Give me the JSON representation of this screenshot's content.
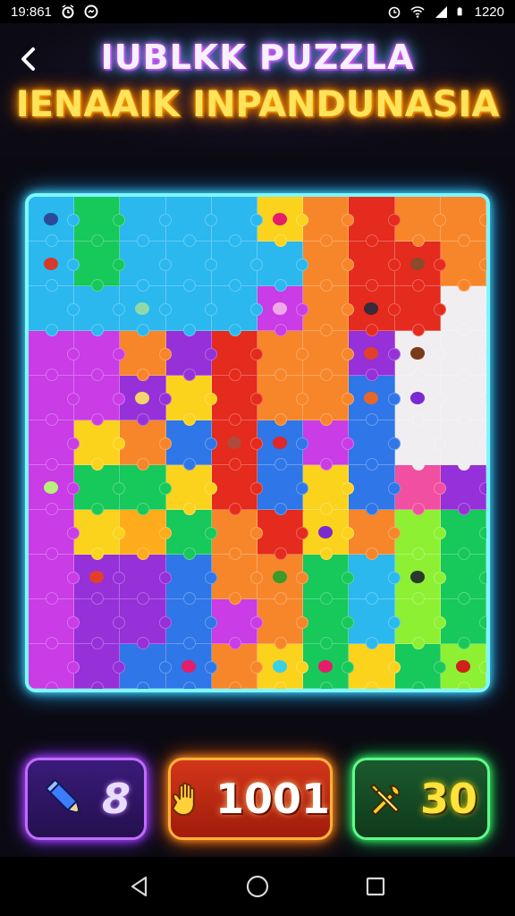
{
  "status_bar": {
    "time": "19:861",
    "battery_text": "1220",
    "left_icons": [
      "alarm-icon",
      "messenger-icon"
    ],
    "right_icons": [
      "alarm-clock-icon",
      "wifi-icon",
      "signal-icon",
      "battery-icon"
    ]
  },
  "header": {
    "back_icon": "chevron-left-icon",
    "title_line1": "IUBLKK PUZZLA",
    "title_line2": "IENAAIK INPANDUNASIA"
  },
  "board": {
    "columns": 10,
    "rows": 11,
    "frame_color": "#7ff7ff",
    "palette": {
      "G": "#17c85b",
      "C": "#2ab8ef",
      "B": "#2f76e8",
      "Y": "#fbd31c",
      "O": "#f7862a",
      "R": "#e52a1e",
      "M": "#c93ce6",
      "P": "#9630d8",
      "W": "#f1eef2",
      "L": "#8df033",
      "K": "#f14fa0",
      "A": "#ffac1c"
    },
    "rows_colors": [
      [
        "C",
        "G",
        "C",
        "C",
        "C",
        "Y",
        "O",
        "R",
        "O",
        "O"
      ],
      [
        "C",
        "G",
        "C",
        "C",
        "C",
        "C",
        "O",
        "R",
        "R",
        "O"
      ],
      [
        "C",
        "C",
        "C",
        "C",
        "C",
        "M",
        "O",
        "R",
        "R",
        "W"
      ],
      [
        "M",
        "M",
        "O",
        "P",
        "R",
        "O",
        "O",
        "P",
        "W",
        "W"
      ],
      [
        "M",
        "M",
        "P",
        "Y",
        "R",
        "O",
        "O",
        "B",
        "W",
        "W"
      ],
      [
        "M",
        "Y",
        "O",
        "B",
        "R",
        "B",
        "M",
        "B",
        "W",
        "W"
      ],
      [
        "M",
        "G",
        "G",
        "Y",
        "R",
        "B",
        "Y",
        "B",
        "K",
        "P"
      ],
      [
        "M",
        "Y",
        "A",
        "G",
        "O",
        "R",
        "Y",
        "O",
        "L",
        "G"
      ],
      [
        "M",
        "P",
        "P",
        "B",
        "O",
        "O",
        "G",
        "C",
        "L",
        "G"
      ],
      [
        "M",
        "P",
        "P",
        "B",
        "M",
        "O",
        "G",
        "C",
        "L",
        "G"
      ],
      [
        "M",
        "P",
        "B",
        "B",
        "O",
        "Y",
        "G",
        "Y",
        "G",
        "L"
      ]
    ],
    "marks": [
      {
        "row": 0,
        "col": 0,
        "color": "#2b4b9a",
        "icon": "bug-icon"
      },
      {
        "row": 0,
        "col": 5,
        "color": "#e51d6a",
        "icon": "gem-icon"
      },
      {
        "row": 1,
        "col": 0,
        "color": "#d63a2a",
        "icon": "gem-icon"
      },
      {
        "row": 1,
        "col": 8,
        "color": "#8b4a2a",
        "icon": "critter-icon"
      },
      {
        "row": 2,
        "col": 2,
        "color": "#8fd9a8",
        "icon": "gem-icon"
      },
      {
        "row": 2,
        "col": 5,
        "color": "#f0a8e8",
        "icon": "gem-icon"
      },
      {
        "row": 2,
        "col": 7,
        "color": "#3a2a3a",
        "icon": "monster-icon"
      },
      {
        "row": 3,
        "col": 7,
        "color": "#e0402a",
        "icon": "critter-icon"
      },
      {
        "row": 3,
        "col": 8,
        "color": "#7a3b1a",
        "icon": "critter-icon"
      },
      {
        "row": 4,
        "col": 2,
        "color": "#f5d56a",
        "icon": "critter-icon"
      },
      {
        "row": 4,
        "col": 7,
        "color": "#e8662a",
        "icon": "gem-icon"
      },
      {
        "row": 4,
        "col": 8,
        "color": "#7a2ad0",
        "icon": "gem-icon"
      },
      {
        "row": 5,
        "col": 4,
        "color": "#b04a3a",
        "icon": "critter-icon"
      },
      {
        "row": 5,
        "col": 5,
        "color": "#e0282a",
        "icon": "gem-icon"
      },
      {
        "row": 6,
        "col": 0,
        "color": "#b7f07a",
        "icon": "gem-icon"
      },
      {
        "row": 7,
        "col": 6,
        "color": "#7a2ad0",
        "icon": "gem-icon"
      },
      {
        "row": 8,
        "col": 1,
        "color": "#e0402a",
        "icon": "critter-icon"
      },
      {
        "row": 8,
        "col": 5,
        "color": "#3a9a2a",
        "icon": "critter-icon"
      },
      {
        "row": 8,
        "col": 8,
        "color": "#2a3a2a",
        "icon": "critter-icon"
      },
      {
        "row": 10,
        "col": 3,
        "color": "#e51d6a",
        "icon": "gem-icon"
      },
      {
        "row": 10,
        "col": 5,
        "color": "#3ad0e8",
        "icon": "gem-icon"
      },
      {
        "row": 10,
        "col": 6,
        "color": "#e51d6a",
        "icon": "gem-icon"
      },
      {
        "row": 10,
        "col": 9,
        "color": "#d0201a",
        "icon": "gem-icon"
      }
    ]
  },
  "counters": {
    "hint": {
      "icon": "pencil-icon",
      "value": "8"
    },
    "moves": {
      "icon": "hand-icon",
      "value": "1001"
    },
    "tools": {
      "icon": "tools-icon",
      "value": "30"
    }
  },
  "nav": {
    "back_icon": "nav-back-icon",
    "home_icon": "nav-home-icon",
    "recents_icon": "nav-recents-icon"
  }
}
